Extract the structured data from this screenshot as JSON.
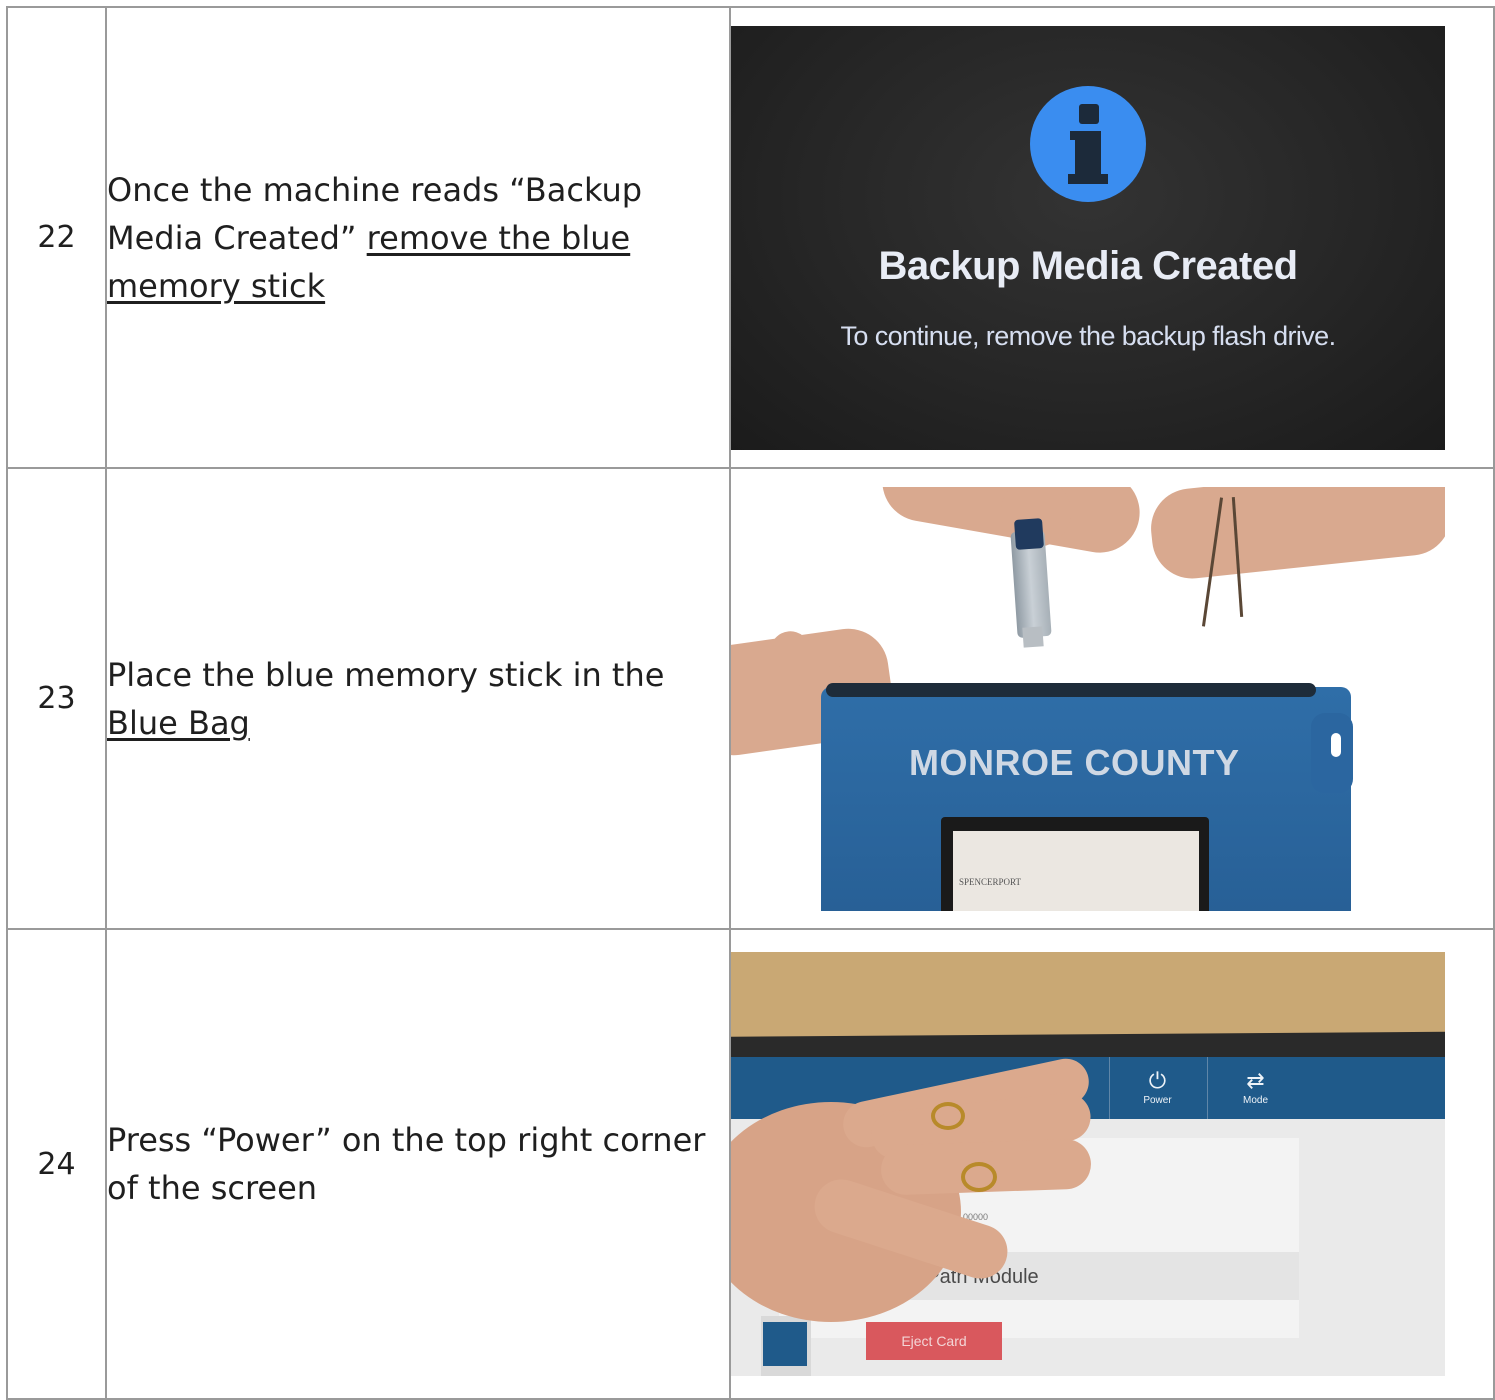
{
  "steps": [
    {
      "number": "22",
      "text_parts": [
        "Once the machine reads “Backup Media Created” ",
        "remove the blue memory stick"
      ],
      "image": {
        "title": "Backup Media Created",
        "subtitle": "To continue, remove the backup flash drive."
      }
    },
    {
      "number": "23",
      "text_parts": [
        "Place the blue memory stick in the ",
        "Blue Bag"
      ],
      "image": {
        "bag_label": "MONROE COUNTY",
        "card_text": "SPENCERPORT"
      }
    },
    {
      "number": "24",
      "text": "Press “Power” on the top right corner of the screen",
      "image": {
        "power_label": "Power",
        "mode_label": "Mode",
        "small_text": "00000",
        "module_text": "er Path Module",
        "eject_label": "Eject Card"
      }
    }
  ]
}
